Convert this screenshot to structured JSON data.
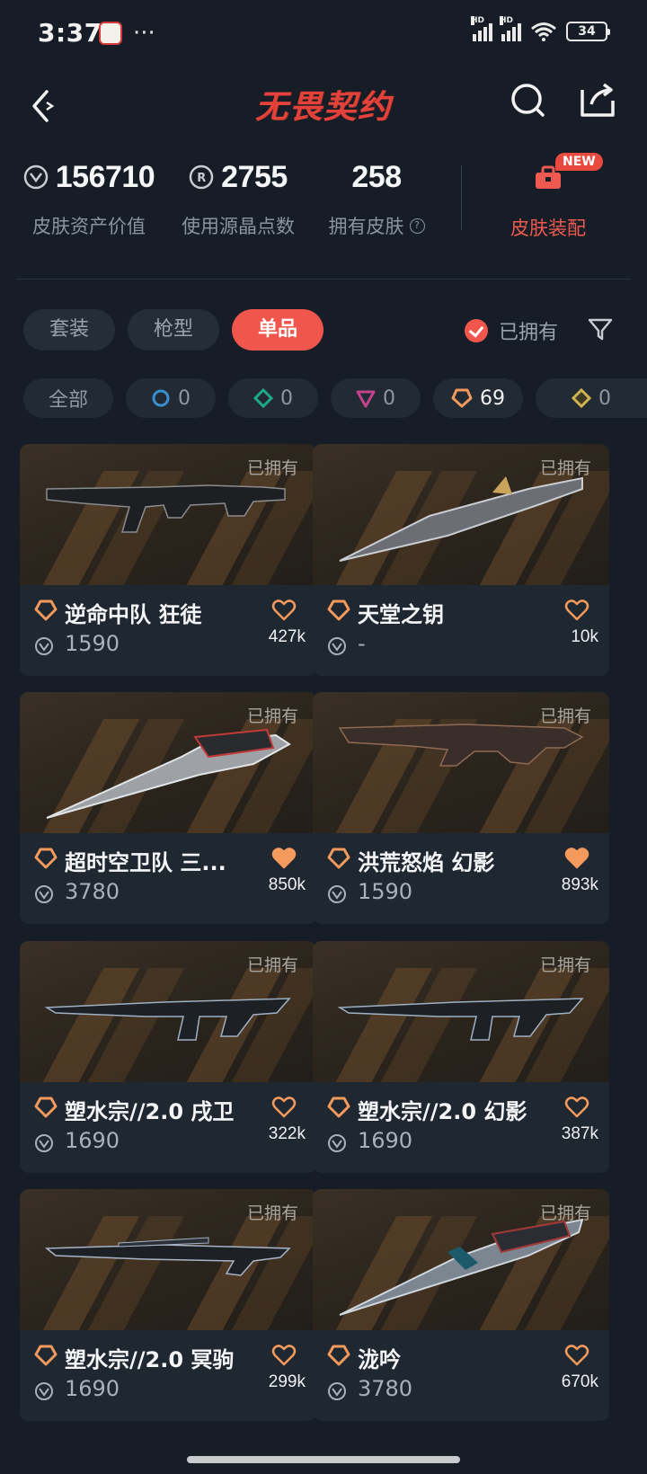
{
  "status_bar": {
    "time": "3:37",
    "more": "···",
    "signal_label": "HD",
    "battery": "34"
  },
  "nav": {
    "logo": "无畏契约"
  },
  "stats": {
    "asset_value": "156710",
    "asset_label": "皮肤资产价值",
    "radianite_points": "2755",
    "radianite_label": "使用源晶点数",
    "skins_owned": "258",
    "skins_owned_label": "拥有皮肤",
    "skin_build_label": "皮肤装配",
    "new_badge": "NEW"
  },
  "tabs": [
    {
      "label": "套装"
    },
    {
      "label": "枪型"
    },
    {
      "label": "单品"
    }
  ],
  "owned_filter": "已拥有",
  "chips": [
    {
      "label": "全部"
    },
    {
      "count": "0"
    },
    {
      "count": "0"
    },
    {
      "count": "0"
    },
    {
      "count": "69"
    },
    {
      "count": "0"
    }
  ],
  "colors": {
    "accent": "#f1564c",
    "tier_orange": "#f39a5c",
    "background": "#161d26"
  },
  "cards": [
    {
      "name": "逆命中队 狂徒",
      "price": "1590",
      "likes": "427k",
      "owned": "已拥有",
      "liked": false
    },
    {
      "name": "天堂之钥",
      "price": "-",
      "likes": "10k",
      "owned": "已拥有",
      "liked": false
    },
    {
      "name": "超时空卫队 三...",
      "price": "3780",
      "likes": "850k",
      "owned": "已拥有",
      "liked": true
    },
    {
      "name": "洪荒怒焰 幻影",
      "price": "1590",
      "likes": "893k",
      "owned": "已拥有",
      "liked": true
    },
    {
      "name": "塑水宗//2.0 戌卫",
      "price": "1690",
      "likes": "322k",
      "owned": "已拥有",
      "liked": false
    },
    {
      "name": "塑水宗//2.0 幻影",
      "price": "1690",
      "likes": "387k",
      "owned": "已拥有",
      "liked": false
    },
    {
      "name": "塑水宗//2.0 冥驹",
      "price": "1690",
      "likes": "299k",
      "owned": "已拥有",
      "liked": false
    },
    {
      "name": "泷吟",
      "price": "3780",
      "likes": "670k",
      "owned": "已拥有",
      "liked": false
    }
  ]
}
